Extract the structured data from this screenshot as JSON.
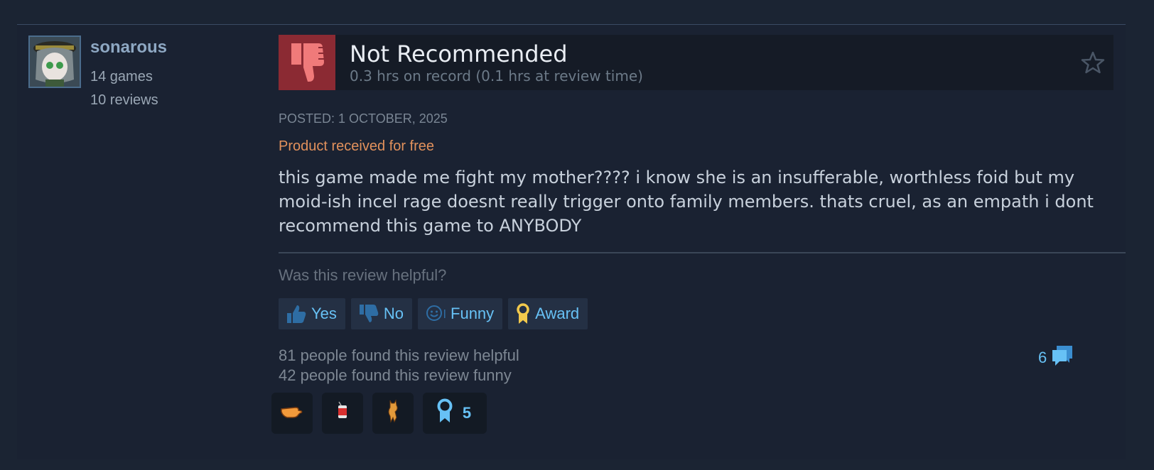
{
  "reviewer": {
    "username": "sonarous",
    "games": "14 games",
    "reviews": "10 reviews"
  },
  "review": {
    "verdict": "Not Recommended",
    "hours": "0.3 hrs on record (0.1 hrs at review time)",
    "posted": "Posted: 1 October, 2025",
    "received_free": "Product received for free",
    "text": "this game made me fight my mother???? i know she is an insufferable, worthless foid but my moid-ish incel rage doesnt really trigger onto family members. thats cruel, as an empath i dont recommend this game to ANYBODY"
  },
  "feedback": {
    "question": "Was this review helpful?",
    "yes_label": "Yes",
    "no_label": "No",
    "funny_label": "Funny",
    "award_label": "Award",
    "helpful_count": "81 people found this review helpful",
    "funny_count": "42 people found this review funny",
    "comment_count": "6"
  },
  "awards": [
    {
      "icon": "pointing-hand-icon"
    },
    {
      "icon": "soda-can-icon"
    },
    {
      "icon": "dancing-cat-icon"
    },
    {
      "icon": "ribbon-medal-icon",
      "count": "5"
    }
  ],
  "colors": {
    "background": "#1b2433",
    "thumb_red": "#8b2a33",
    "link_blue": "#67c1f5",
    "free_orange": "#e2915c"
  }
}
